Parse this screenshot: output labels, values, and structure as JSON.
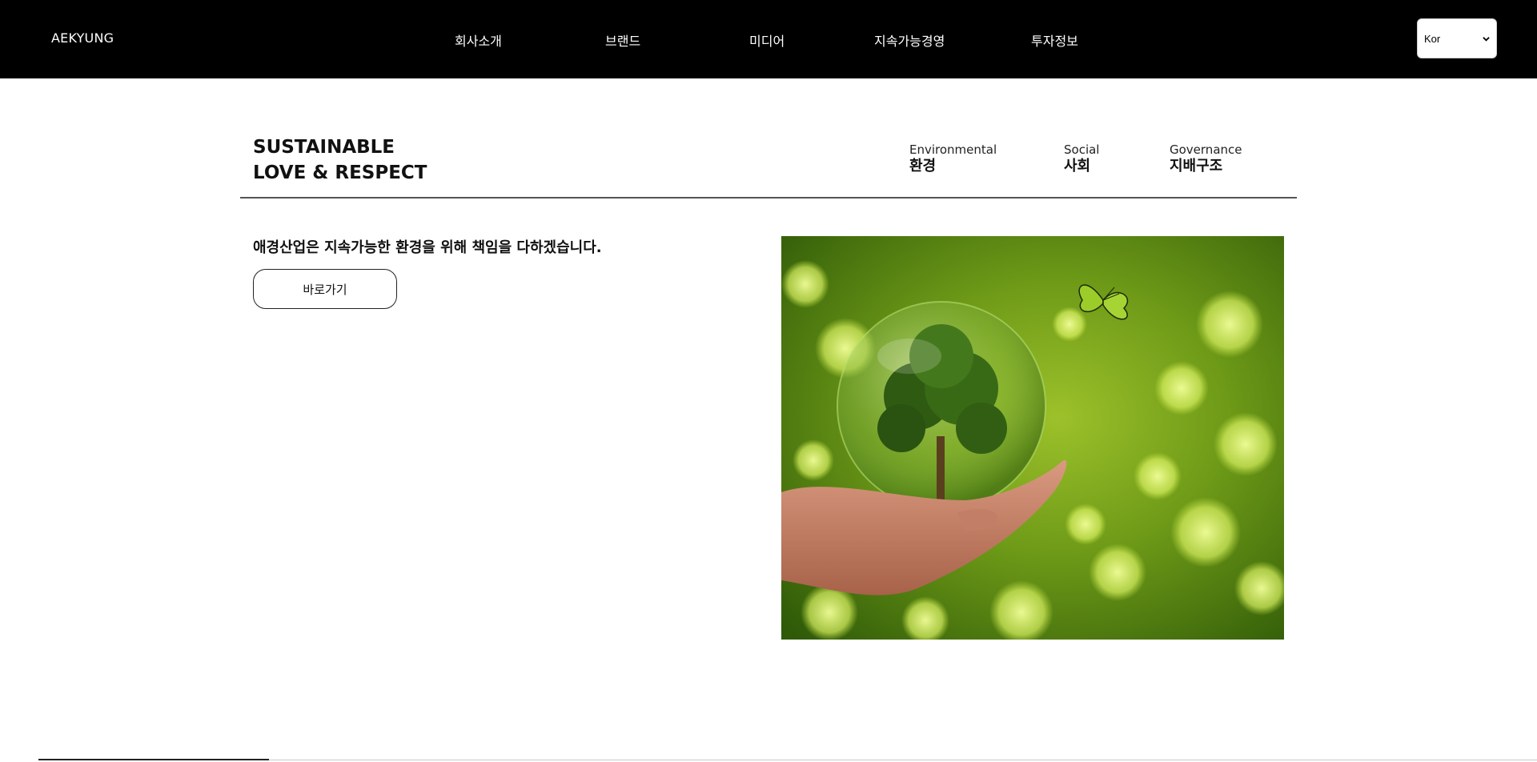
{
  "header": {
    "logo": "AEKYUNG",
    "nav": [
      "회사소개",
      "브랜드",
      "미디어",
      "지속가능경영",
      "투자정보"
    ],
    "language": {
      "selected": "Kor"
    }
  },
  "section": {
    "headline_line1": "SUSTAINABLE",
    "headline_line2": "LOVE & RESPECT",
    "tabs": [
      {
        "en": "Environmental",
        "ko": "환경"
      },
      {
        "en": "Social",
        "ko": "사회"
      },
      {
        "en": "Governance",
        "ko": "지배구조"
      }
    ],
    "tagline": "애경산업은 지속가능한 환경을 위해 책임을 다하겠습니다.",
    "button_label": "바로가기"
  },
  "colors": {
    "header_bg": "#000000",
    "page_bg": "#ffffff",
    "image_green": "#7fae1e"
  }
}
